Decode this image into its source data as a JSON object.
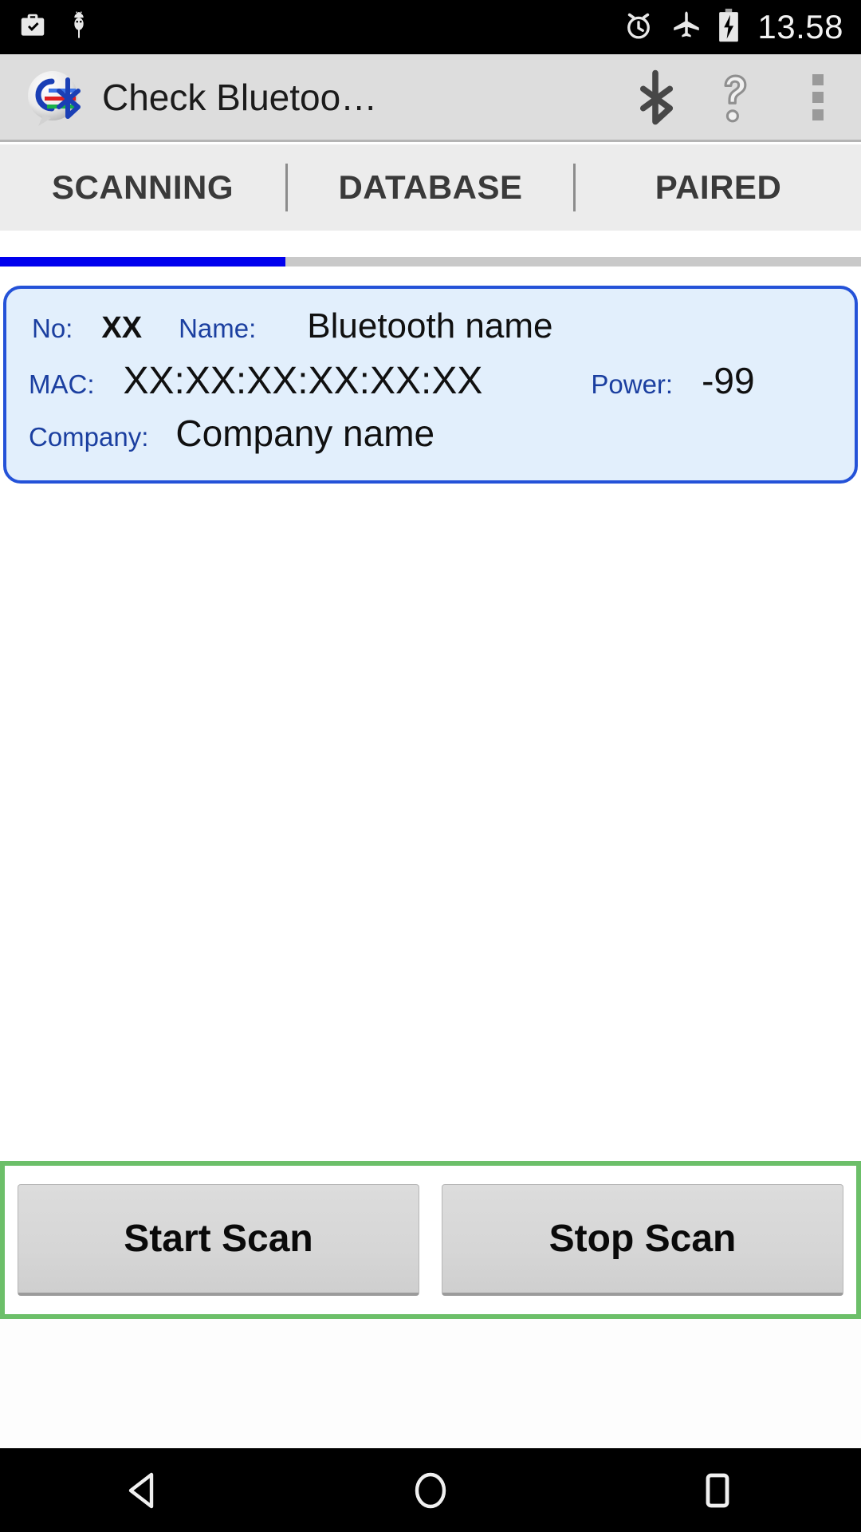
{
  "status_bar": {
    "icons": [
      {
        "name": "work-profile-icon",
        "glyph": "briefcase-check"
      },
      {
        "name": "usb-debugging-icon",
        "glyph": "android-bug"
      },
      {
        "name": "alarm-icon",
        "glyph": "alarm-clock"
      },
      {
        "name": "airplane-mode-icon",
        "glyph": "airplane"
      },
      {
        "name": "battery-charging-icon",
        "glyph": "battery-bolt"
      }
    ],
    "clock": "13.58"
  },
  "action_bar": {
    "app_icon_name": "check-bluetooth-app-icon",
    "title": "Check Bluetoo…",
    "actions": [
      {
        "name": "bluetooth-toggle-icon",
        "label": "Bluetooth"
      },
      {
        "name": "help-icon",
        "label": "Help"
      },
      {
        "name": "overflow-menu-icon",
        "label": "More options"
      }
    ]
  },
  "tabs": {
    "items": [
      {
        "label": "SCANNING",
        "selected": true
      },
      {
        "label": "DATABASE",
        "selected": false
      },
      {
        "label": "PAIRED",
        "selected": false
      }
    ],
    "indicator_color": "#0000ee"
  },
  "device_card": {
    "no_label": "No:",
    "no_value": "XX",
    "name_label": "Name:",
    "name_value": "Bluetooth name",
    "mac_label": "MAC:",
    "mac_value": "XX:XX:XX:XX:XX:XX",
    "power_label": "Power:",
    "power_value": "-99",
    "company_label": "Company:",
    "company_value": "Company name",
    "border_color": "#2452d8",
    "background_color": "#e2effc",
    "label_color": "#1b3fa0"
  },
  "buttons": {
    "start_scan": "Start Scan",
    "stop_scan": "Stop Scan",
    "highlight_color": "#6cbf69"
  },
  "nav_bar": {
    "back": "back-button",
    "home": "home-button",
    "recents": "recents-button"
  }
}
